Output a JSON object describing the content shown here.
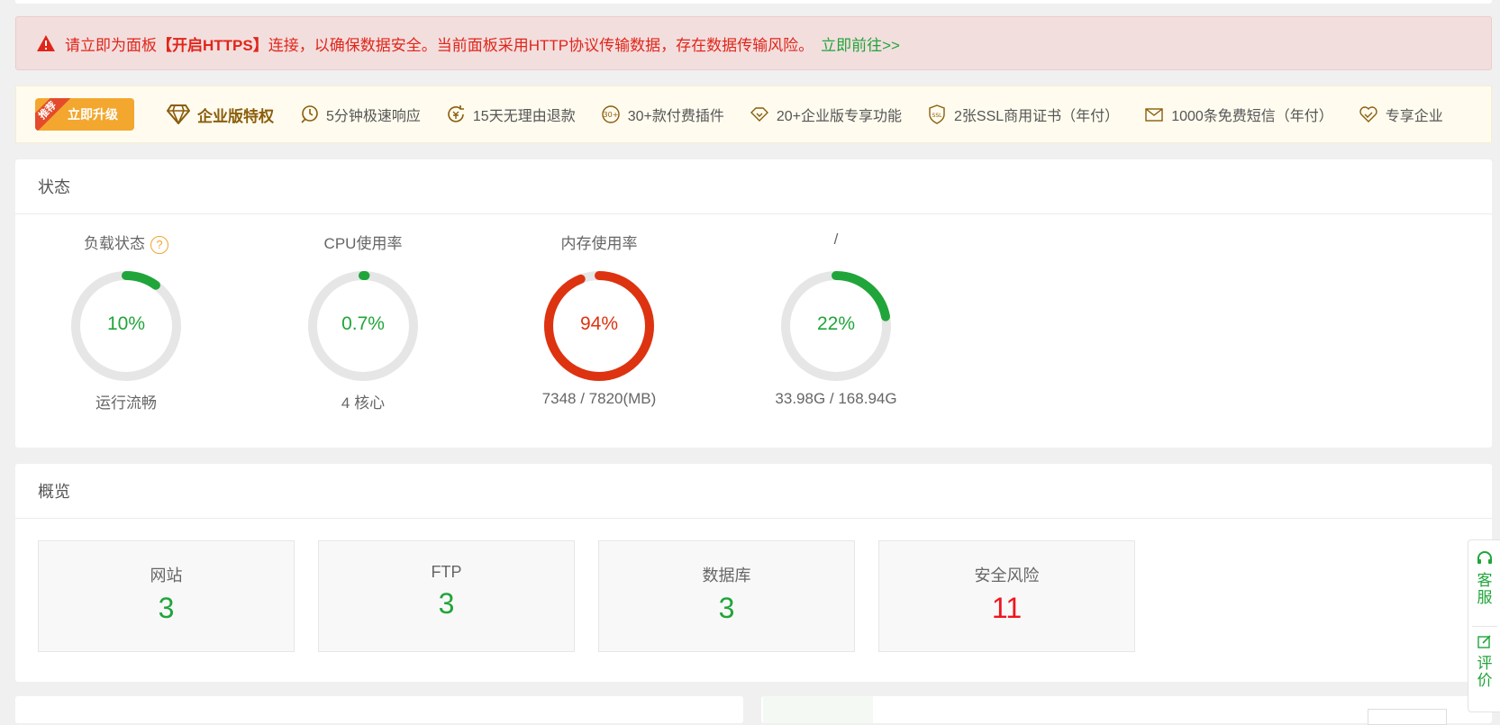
{
  "colors": {
    "green": "#20a53a",
    "red": "#f0141e",
    "danger": "#e0261a",
    "gold": "#f3a72f",
    "track": "#e6e6e6"
  },
  "alert": {
    "icon": "warning-triangle-icon",
    "text_prefix": "请立即为面板",
    "text_strong": "【开启HTTPS】",
    "text_suffix": "连接，以确保数据安全。当前面板采用HTTP协议传输数据，存在数据传输风险。",
    "link": "立即前往>>"
  },
  "enterprise": {
    "ribbon": "推荐",
    "upgrade_label": "立即升级",
    "title": "企业版特权",
    "features": [
      {
        "label": "5分钟极速响应",
        "icon": "clock-icon"
      },
      {
        "label": "15天无理由退款",
        "icon": "refund-icon"
      },
      {
        "label": "30+款付费插件",
        "icon": "plugin-30-icon"
      },
      {
        "label": "20+企业版专享功能",
        "icon": "diamond-icon"
      },
      {
        "label": "2张SSL商用证书（年付）",
        "icon": "ssl-shield-icon"
      },
      {
        "label": "1000条免费短信（年付）",
        "icon": "mail-icon"
      },
      {
        "label": "专享企业",
        "icon": "heart-service-icon"
      }
    ]
  },
  "status": {
    "title": "状态",
    "gauges": [
      {
        "id": "load",
        "title": "负载状态",
        "help": "?",
        "value": "10%",
        "percent": 10,
        "sub": "运行流畅",
        "color": "#20a53a"
      },
      {
        "id": "cpu",
        "title": "CPU使用率",
        "value": "0.7%",
        "percent": 0.7,
        "sub": "4 核心",
        "color": "#20a53a"
      },
      {
        "id": "mem",
        "title": "内存使用率",
        "value": "94%",
        "percent": 94,
        "sub": "7348 / 7820(MB)",
        "color": "#dd3310"
      },
      {
        "id": "disk",
        "title": "/",
        "value": "22%",
        "percent": 22,
        "sub": "33.98G / 168.94G",
        "color": "#20a53a"
      }
    ]
  },
  "overview": {
    "title": "概览",
    "cards": [
      {
        "label": "网站",
        "value": "3",
        "color": "#20a53a"
      },
      {
        "label": "FTP",
        "value": "3",
        "color": "#20a53a"
      },
      {
        "label": "数据库",
        "value": "3",
        "color": "#20a53a"
      },
      {
        "label": "安全风险",
        "value": "11",
        "color": "#f0141e"
      }
    ]
  },
  "side_tool": {
    "service_label": "客服",
    "review_label": "评价"
  }
}
